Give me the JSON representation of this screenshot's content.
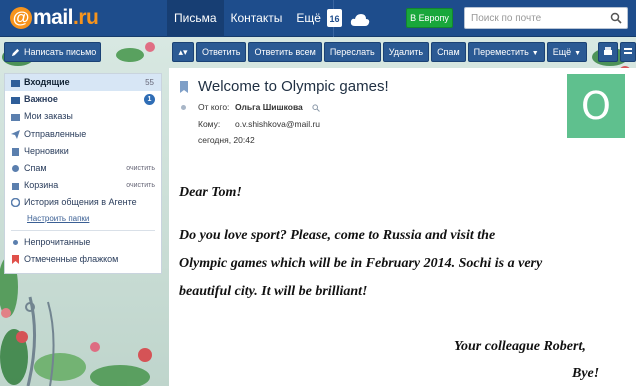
{
  "header": {
    "logo": {
      "at": "@",
      "name": "mail",
      "tld": ".ru"
    },
    "nav": [
      {
        "label": "Письма",
        "active": true
      },
      {
        "label": "Контакты",
        "active": false
      },
      {
        "label": "Ещё",
        "active": false
      }
    ],
    "calendar_day": "16",
    "europe_button": "В Европу",
    "search_placeholder": "Поиск по почте"
  },
  "toolbar": {
    "compose_label": "Написать письмо",
    "buttons": [
      {
        "label": "Ответить"
      },
      {
        "label": "Ответить всем"
      },
      {
        "label": "Переслать"
      },
      {
        "label": "Удалить"
      },
      {
        "label": "Спам"
      },
      {
        "label": "Переместить"
      },
      {
        "label": "Ещё"
      }
    ]
  },
  "sidebar": {
    "folders": [
      {
        "label": "Входящие",
        "count": "55"
      },
      {
        "label": "Важное",
        "badge": "1"
      },
      {
        "label": "Мои заказы"
      },
      {
        "label": "Отправленные"
      },
      {
        "label": "Черновики"
      },
      {
        "label": "Спам",
        "action": "очистить"
      },
      {
        "label": "Корзина",
        "action": "очистить"
      },
      {
        "label": "История общения в Агенте"
      }
    ],
    "settings_link": "Настроить папки",
    "extra": [
      {
        "label": "Непрочитанные"
      },
      {
        "label": "Отмеченные флажком"
      }
    ]
  },
  "message": {
    "subject": "Welcome to Olympic games!",
    "from_label": "От кого:",
    "from_name": "Ольга Шишкова",
    "to_label": "Кому:",
    "to_value": "o.v.shishkova@mail.ru",
    "date": "сегодня, 20:42",
    "avatar_letter": "О",
    "body": {
      "greeting": "Dear Tom!",
      "line1": "Do you love sport?  Please,  come to Russia and visit the",
      "line2": "Olympic games which will  be in  February 2014. Sochi  is  a very",
      "line3": "beautiful city. It will be brilliant!",
      "closing": "Your colleague Robert,",
      "bye": "Bye!"
    }
  },
  "colors": {
    "header_bg": "#1e4d8c",
    "accent_orange": "#f7941d",
    "europe_green": "#19a73b",
    "avatar_green": "#5fc08e",
    "button_blue": "#2b5a94"
  }
}
